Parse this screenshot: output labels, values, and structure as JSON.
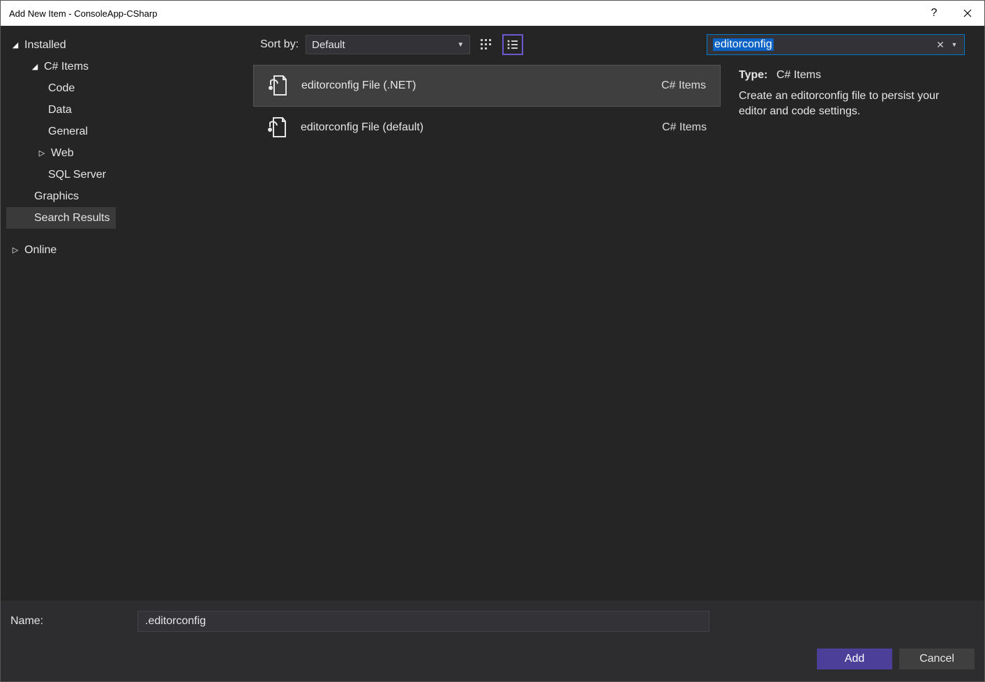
{
  "titlebar": {
    "title": "Add New Item - ConsoleApp-CSharp"
  },
  "sidebar": {
    "groups": [
      {
        "label": "Installed",
        "expanded": true
      },
      {
        "label": "C# Items",
        "expanded": true
      },
      {
        "label": "Code"
      },
      {
        "label": "Data"
      },
      {
        "label": "General"
      },
      {
        "label": "Web",
        "collapsed": true
      },
      {
        "label": "SQL Server"
      },
      {
        "label": "Graphics"
      },
      {
        "label": "Search Results",
        "selected": true
      },
      {
        "label": "Online",
        "collapsed": true
      }
    ]
  },
  "toolbar": {
    "sort_label": "Sort by:",
    "sort_value": "Default"
  },
  "search": {
    "value": "editorconfig"
  },
  "items": [
    {
      "label": "editorconfig File (.NET)",
      "lang": "C# Items",
      "selected": true
    },
    {
      "label": "editorconfig File (default)",
      "lang": "C# Items",
      "selected": false
    }
  ],
  "details": {
    "type_label": "Type:",
    "type_value": "C# Items",
    "description": "Create an editorconfig file to persist your editor and code settings."
  },
  "footer": {
    "name_label": "Name:",
    "name_value": ".editorconfig",
    "add_label": "Add",
    "cancel_label": "Cancel"
  }
}
